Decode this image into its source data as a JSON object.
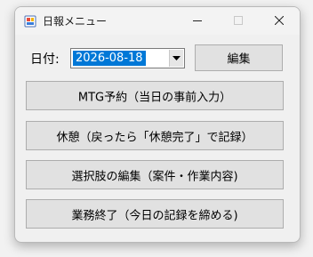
{
  "window": {
    "title": "日報メニュー"
  },
  "date": {
    "label": "日付:",
    "value": "2026-08-18",
    "edit_label": "編集"
  },
  "actions": [
    {
      "label": "MTG予約（当日の事前入力）"
    },
    {
      "label": "休憩（戻ったら「休憩完了」で記録）"
    },
    {
      "label": "選択肢の編集（案件・作業内容)"
    },
    {
      "label": "業務終了（今日の記録を締める)"
    }
  ],
  "colors": {
    "selection": "#0078d7",
    "button_face": "#e1e1e1",
    "button_border": "#adadad"
  }
}
